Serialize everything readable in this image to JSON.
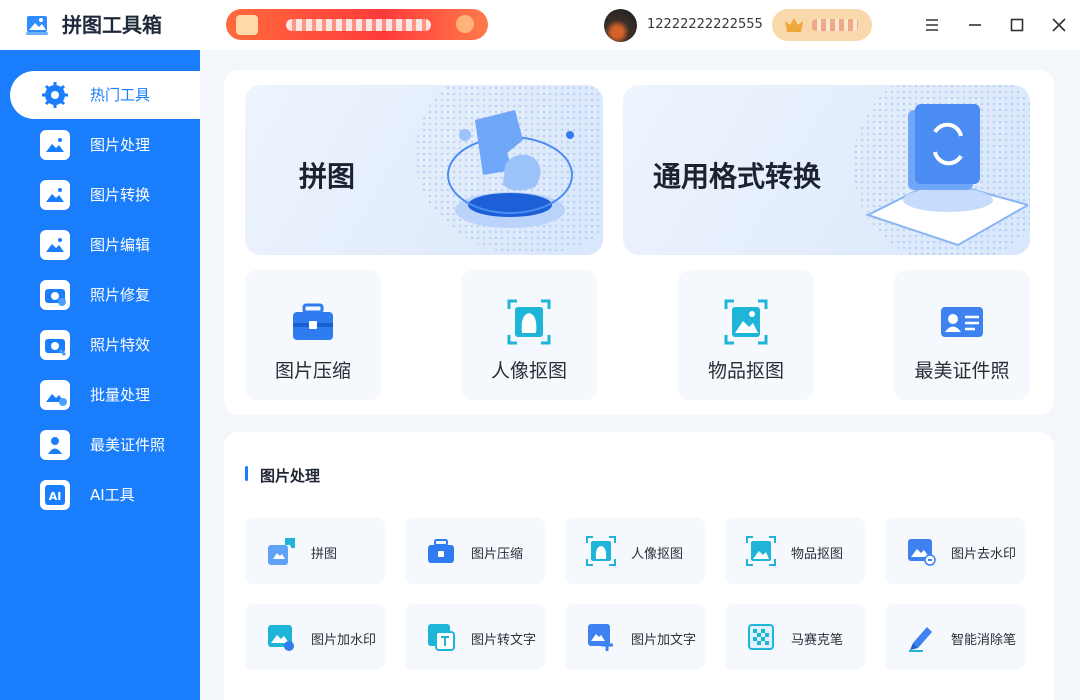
{
  "app": {
    "title": "拼图工具箱"
  },
  "user": {
    "phone": "12222222222555"
  },
  "sidebar": {
    "items": [
      {
        "label": "热门工具",
        "icon": "gear-icon",
        "active": true
      },
      {
        "label": "图片处理",
        "icon": "image-process-icon"
      },
      {
        "label": "图片转换",
        "icon": "image-convert-icon"
      },
      {
        "label": "图片编辑",
        "icon": "image-edit-icon"
      },
      {
        "label": "照片修复",
        "icon": "camera-repair-icon"
      },
      {
        "label": "照片特效",
        "icon": "camera-effect-icon"
      },
      {
        "label": "批量处理",
        "icon": "batch-icon"
      },
      {
        "label": "最美证件照",
        "icon": "id-photo-icon"
      },
      {
        "label": "AI工具",
        "icon": "ai-icon"
      }
    ]
  },
  "hot": {
    "banners": [
      {
        "label": "拼图",
        "icon": "puzzle-illustration"
      },
      {
        "label": "通用格式转换",
        "icon": "convert-illustration"
      }
    ],
    "tiles": [
      {
        "label": "图片压缩",
        "icon": "toolbox-icon"
      },
      {
        "label": "人像抠图",
        "icon": "portrait-cutout-icon"
      },
      {
        "label": "物品抠图",
        "icon": "object-cutout-icon"
      },
      {
        "label": "最美证件照",
        "icon": "id-card-icon"
      }
    ]
  },
  "section": {
    "title": "图片处理",
    "tools": [
      {
        "label": "拼图",
        "icon": "puzzle-icon"
      },
      {
        "label": "图片压缩",
        "icon": "toolbox-icon"
      },
      {
        "label": "人像抠图",
        "icon": "portrait-cutout-icon"
      },
      {
        "label": "物品抠图",
        "icon": "object-cutout-icon"
      },
      {
        "label": "图片去水印",
        "icon": "remove-watermark-icon"
      },
      {
        "label": "图片加水印",
        "icon": "add-watermark-icon"
      },
      {
        "label": "图片转文字",
        "icon": "image-to-text-icon"
      },
      {
        "label": "图片加文字",
        "icon": "add-text-icon"
      },
      {
        "label": "马赛克笔",
        "icon": "mosaic-icon"
      },
      {
        "label": "智能消除笔",
        "icon": "eraser-pen-icon"
      }
    ]
  },
  "colors": {
    "primary": "#1a7dfb",
    "vip": "#f9d9ac",
    "promo": "#ff3b3b"
  }
}
